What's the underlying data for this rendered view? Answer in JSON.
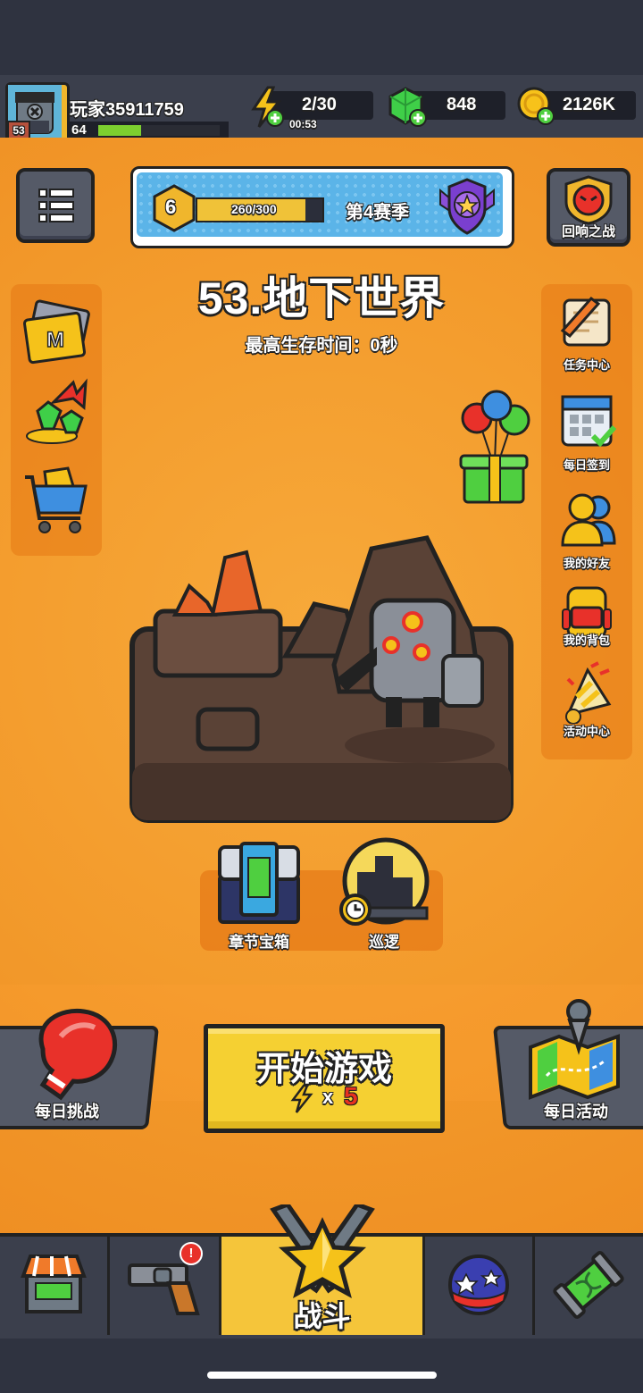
{
  "player": {
    "name": "玩家35911759",
    "level": "64",
    "avatar_level": "53",
    "xp_fraction": 0.35
  },
  "resources": {
    "energy": "2/30",
    "energy_timer": "00:53",
    "gems": "848",
    "coins": "2126K"
  },
  "season": {
    "level": "6",
    "progress": "260/300",
    "progress_fraction": 0.8667,
    "label": "第4赛季"
  },
  "echo_battle": {
    "label": "回响之战"
  },
  "chapter": {
    "title": "53.地下世界",
    "best_time": "最高生存时间：0秒"
  },
  "right_menu": [
    {
      "label": "任务中心",
      "icon": "scroll-quill-icon"
    },
    {
      "label": "每日签到",
      "icon": "calendar-check-icon"
    },
    {
      "label": "我的好友",
      "icon": "friends-icon"
    },
    {
      "label": "我的背包",
      "icon": "backpack-icon"
    },
    {
      "label": "活动中心",
      "icon": "party-popper-icon"
    }
  ],
  "left_menu": [
    {
      "icon": "m-card-icon"
    },
    {
      "icon": "gem-upgrade-icon"
    },
    {
      "icon": "shop-cart-icon"
    }
  ],
  "stage_actions": {
    "chest_label": "章节宝箱",
    "patrol_label": "巡逻"
  },
  "buttons": {
    "daily_challenge": "每日挑战",
    "start_game": "开始游戏",
    "start_cost_prefix": "x",
    "start_cost": "5",
    "daily_event": "每日活动"
  },
  "bottom_nav": {
    "battle_label": "战斗",
    "items": [
      "shop-icon",
      "weapon-icon",
      "battle-icon",
      "talent-ball-icon",
      "evolution-icon"
    ],
    "weapon_badge": "!"
  },
  "colors": {
    "main_bg": "#f39b2c",
    "gem_green": "#3fcf48",
    "coin_yellow": "#f7c21a",
    "start_button": "#f5d032",
    "cost_red": "#e8311f"
  }
}
